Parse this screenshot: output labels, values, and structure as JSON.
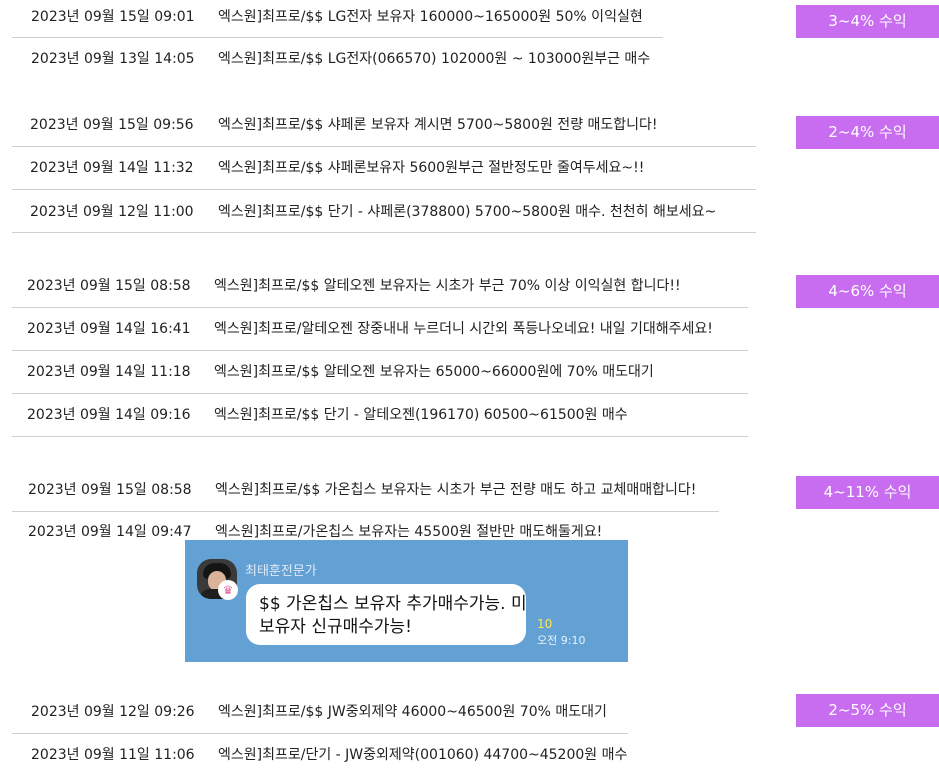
{
  "groups": [
    {
      "badge": "3~4% 수익",
      "rows": [
        {
          "date": "2023년 09월 15일 09:01",
          "text": "엑스원]최프로/$$ LG전자 보유자 160000~165000원 50% 이익실현"
        },
        {
          "date": "2023년 09월 13일 14:05",
          "text": "엑스원]최프로/$$ LG전자(066570) 102000원 ~ 103000원부근 매수"
        }
      ]
    },
    {
      "badge": "2~4% 수익",
      "rows": [
        {
          "date": "2023년 09월 15일 09:56",
          "text": "엑스원]최프로/$$ 샤페론 보유자 계시면 5700~5800원 전량 매도합니다!"
        },
        {
          "date": "2023년 09월 14일 11:32",
          "text": "엑스원]최프로/$$ 샤페론보유자 5600원부근 절반정도만 줄여두세요~!!"
        },
        {
          "date": "2023년 09월 12일 11:00",
          "text": "엑스원]최프로/$$ 단기 - 샤페론(378800) 5700~5800원 매수. 천천히 해보세요~"
        }
      ]
    },
    {
      "badge": "4~6% 수익",
      "rows": [
        {
          "date": "2023년 09월 15일 08:58",
          "text": "엑스원]최프로/$$ 알테오젠 보유자는 시초가 부근 70% 이상 이익실현 합니다!!"
        },
        {
          "date": "2023년 09월 14일 16:41",
          "text": "엑스원]최프로/알테오젠 장중내내 누르더니 시간외 폭등나오네요! 내일 기대해주세요!"
        },
        {
          "date": "2023년 09월 14일 11:18",
          "text": "엑스원]최프로/$$ 알테오젠 보유자는 65000~66000원에 70% 매도대기"
        },
        {
          "date": "2023년 09월 14일 09:16",
          "text": "엑스원]최프로/$$ 단기 - 알테오젠(196170) 60500~61500원 매수"
        }
      ]
    },
    {
      "badge": "4~11% 수익",
      "rows": [
        {
          "date": "2023년 09월 15일 08:58",
          "text": "엑스원]최프로/$$ 가온칩스 보유자는 시초가 부근 전량 매도 하고 교체매매합니다!"
        },
        {
          "date": "2023년 09월 14일 09:47",
          "text": "엑스원]최프로/가온칩스 보유자는 45500원 절반만 매도해둘게요!"
        }
      ]
    },
    {
      "badge": "2~5% 수익",
      "rows": [
        {
          "date": "2023년 09월 12일 09:26",
          "text": "엑스원]최프로/$$ JW중외제약 46000~46500원 70% 매도대기"
        },
        {
          "date": "2023년 09월 11일 11:06",
          "text": "엑스원]최프로/단기 - JW중외제약(001060) 44700~45200원 매수"
        }
      ]
    }
  ],
  "chat": {
    "sender": "최태훈전문가",
    "message_line1": "$$ 가온칩스 보유자 추가매수가능. 미",
    "message_line2": "보유자 신규매수가능!",
    "unread_count": "10",
    "time": "오전 9:10"
  },
  "colors": {
    "badge": "#c86df0",
    "chat_background": "#63a1d5",
    "separator": "#cfcfcf"
  }
}
